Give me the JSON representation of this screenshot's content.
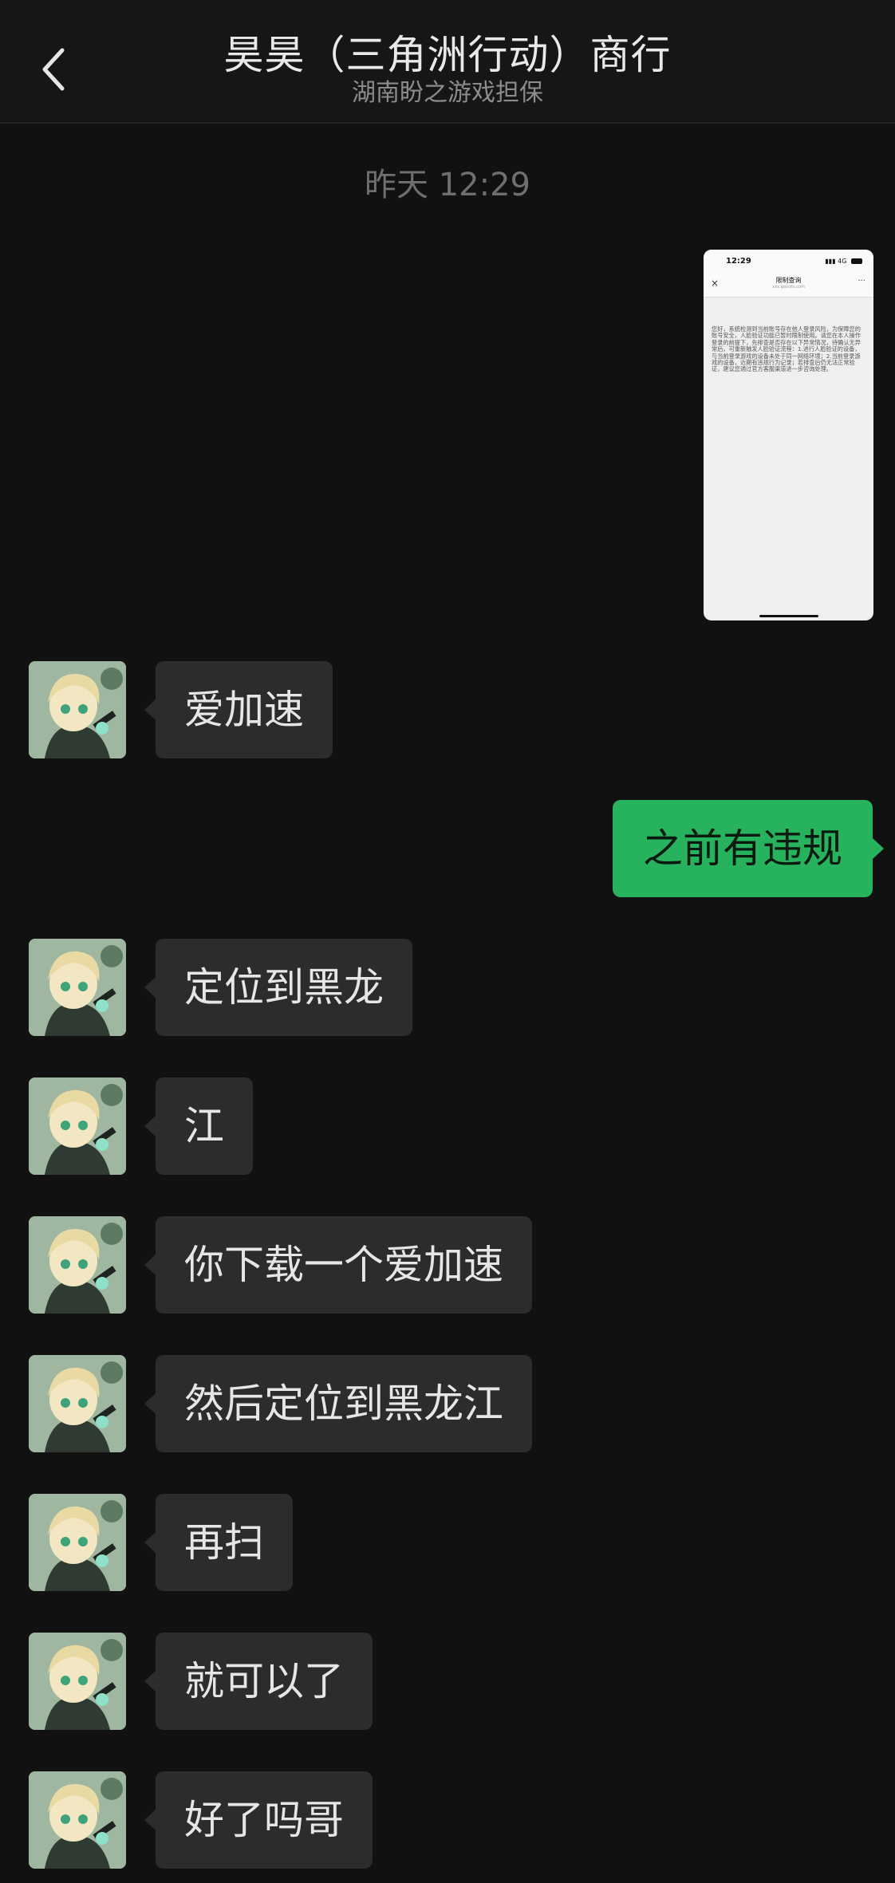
{
  "header": {
    "title": "昊昊（三角洲行动）商行",
    "subtitle": "湖南盼之游戏担保"
  },
  "timestamp": "昨天 12:29",
  "image_message": {
    "status_time": "12:29",
    "status_icons": "4G",
    "title": "限制查询",
    "url": "xxx.ipanzhi.com",
    "body": "您好，系统检测到当前账号存在他人登录风险，为保障您的账号安全，人脸验证功能已暂时限制使用。请您在本人操作登录的前提下，先排查是否存在以下异常情况，待确认无异常后，可重新触发人脸验证流程：1.进行人脸验证的设备，与当前登录游戏的设备未处于同一网络环境；2.当前登录游戏的设备，近期有违规行为记录；若排查后仍无法正常验证，建议您通过官方客服渠道进一步咨询处理。"
  },
  "messages": [
    {
      "side": "left",
      "text": "爱加速"
    },
    {
      "side": "right",
      "text": "之前有违规"
    },
    {
      "side": "left",
      "text": "定位到黑龙"
    },
    {
      "side": "left",
      "text": "江"
    },
    {
      "side": "left",
      "text": "你下载一个爱加速"
    },
    {
      "side": "left",
      "text": "然后定位到黑龙江"
    },
    {
      "side": "left",
      "text": "再扫"
    },
    {
      "side": "left",
      "text": "就可以了"
    },
    {
      "side": "left",
      "text": "好了吗哥"
    }
  ],
  "colors": {
    "background": "#111111",
    "incoming_bubble": "#2c2c2c",
    "outgoing_bubble": "#27b35d"
  },
  "icons": {
    "back": "chevron-left-icon"
  }
}
